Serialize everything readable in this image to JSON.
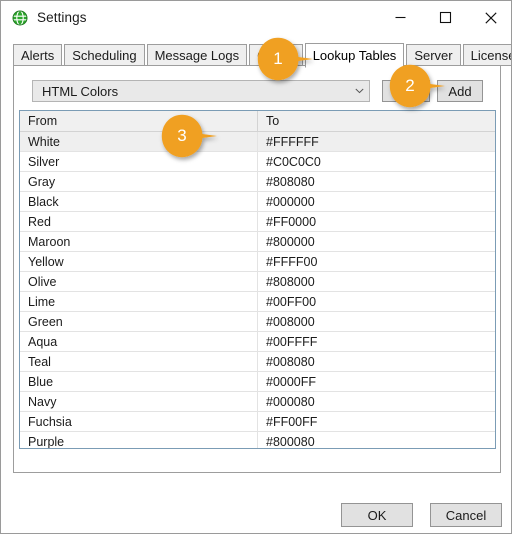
{
  "window": {
    "title": "Settings",
    "icon": "green-globe-icon",
    "controls": {
      "minimize": "minimize-icon",
      "maximize": "maximize-icon",
      "close": "close-icon"
    }
  },
  "tabs": [
    {
      "label": "Alerts",
      "active": false
    },
    {
      "label": "Scheduling",
      "active": false
    },
    {
      "label": "Message Logs",
      "active": false
    },
    {
      "label": "Global",
      "active": false
    },
    {
      "label": "Lookup Tables",
      "active": true
    },
    {
      "label": "Server",
      "active": false
    },
    {
      "label": "License",
      "active": false
    }
  ],
  "lookup_tables": {
    "combo": {
      "value": "HTML Colors",
      "arrow_icon": "chevron-down-icon"
    },
    "buttons": {
      "hidden_label": "",
      "add_label": "Add"
    },
    "grid": {
      "columns": [
        "From",
        "To"
      ],
      "rows": [
        {
          "from": "White",
          "to": "#FFFFFF",
          "selected": true
        },
        {
          "from": "Silver",
          "to": "#C0C0C0",
          "selected": false
        },
        {
          "from": "Gray",
          "to": "#808080",
          "selected": false
        },
        {
          "from": "Black",
          "to": "#000000",
          "selected": false
        },
        {
          "from": "Red",
          "to": "#FF0000",
          "selected": false
        },
        {
          "from": "Maroon",
          "to": "#800000",
          "selected": false
        },
        {
          "from": "Yellow",
          "to": "#FFFF00",
          "selected": false
        },
        {
          "from": "Olive",
          "to": "#808000",
          "selected": false
        },
        {
          "from": "Lime",
          "to": "#00FF00",
          "selected": false
        },
        {
          "from": "Green",
          "to": "#008000",
          "selected": false
        },
        {
          "from": "Aqua",
          "to": "#00FFFF",
          "selected": false
        },
        {
          "from": "Teal",
          "to": "#008080",
          "selected": false
        },
        {
          "from": "Blue",
          "to": "#0000FF",
          "selected": false
        },
        {
          "from": "Navy",
          "to": "#000080",
          "selected": false
        },
        {
          "from": "Fuchsia",
          "to": "#FF00FF",
          "selected": false
        },
        {
          "from": "Purple",
          "to": "#800080",
          "selected": false
        },
        {
          "from": "",
          "to": "",
          "selected": false
        }
      ]
    }
  },
  "dialog": {
    "ok_label": "OK",
    "cancel_label": "Cancel"
  },
  "callouts": [
    {
      "number": "1"
    },
    {
      "number": "2"
    },
    {
      "number": "3"
    }
  ],
  "colors": {
    "callout": "#F0A020",
    "tab_inactive": "#EFEFEF",
    "grid_border": "#7B9CB5",
    "selection": "#EFEFEF",
    "icon_green": "#2EA82E"
  }
}
